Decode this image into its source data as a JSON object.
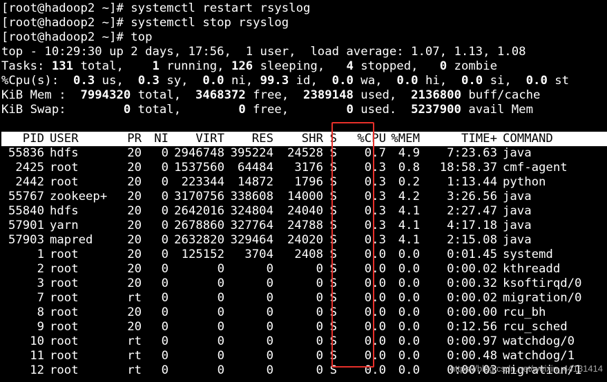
{
  "commands": [
    "[root@hadoop2 ~]# systemctl restart rsyslog",
    "[root@hadoop2 ~]# systemctl stop rsyslog",
    "[root@hadoop2 ~]# top"
  ],
  "summary": {
    "top_line": "top - 10:29:30 up 2 days, 17:56,  1 user,  load average: 1.07, 1.13, 1.08",
    "tasks": {
      "label": "Tasks:",
      "total": "131",
      "total_lbl": " total,",
      "running": "1",
      "running_lbl": " running,",
      "sleeping": "126",
      "sleeping_lbl": " sleeping,",
      "stopped": "4",
      "stopped_lbl": " stopped,",
      "zombie": "0",
      "zombie_lbl": " zombie"
    },
    "cpu": {
      "label": "%Cpu(s):",
      "us": "0.3",
      "us_lbl": " us,",
      "sy": "0.3",
      "sy_lbl": " sy,",
      "ni": "0.0",
      "ni_lbl": " ni,",
      "id": "99.3",
      "id_lbl": " id,",
      "wa": "0.0",
      "wa_lbl": " wa,",
      "hi": "0.0",
      "hi_lbl": " hi,",
      "si": "0.0",
      "si_lbl": " si,",
      "st": "0.0",
      "st_lbl": " st"
    },
    "mem": {
      "label": "KiB Mem :",
      "total": "7994320",
      "total_lbl": " total,",
      "free": "3468372",
      "free_lbl": " free,",
      "used": "2389148",
      "used_lbl": " used,",
      "buff": "2136800",
      "buff_lbl": " buff/cache"
    },
    "swap": {
      "label": "KiB Swap:",
      "total": "0",
      "total_lbl": " total,",
      "free": "0",
      "free_lbl": " free,",
      "used": "0",
      "used_lbl": " used.",
      "avail": "5237900",
      "avail_lbl": " avail Mem"
    }
  },
  "columns": {
    "pid": "PID",
    "user": "USER",
    "pr": "PR",
    "ni": "NI",
    "virt": "VIRT",
    "res": "RES",
    "shr": "SHR",
    "s": "S",
    "cpu": "%CPU",
    "mem": "%MEM",
    "time": "TIME+",
    "cmd": "COMMAND"
  },
  "processes": [
    {
      "pid": "55836",
      "user": "hdfs",
      "pr": "20",
      "ni": "0",
      "virt": "2946748",
      "res": "395224",
      "shr": "24528",
      "s": "S",
      "cpu": "0.7",
      "mem": "4.9",
      "time": "7:23.63",
      "cmd": "java"
    },
    {
      "pid": "2425",
      "user": "root",
      "pr": "20",
      "ni": "0",
      "virt": "1537560",
      "res": "64484",
      "shr": "3176",
      "s": "S",
      "cpu": "0.3",
      "mem": "0.8",
      "time": "18:58.37",
      "cmd": "cmf-agent"
    },
    {
      "pid": "2442",
      "user": "root",
      "pr": "20",
      "ni": "0",
      "virt": "223344",
      "res": "14872",
      "shr": "1796",
      "s": "S",
      "cpu": "0.3",
      "mem": "0.2",
      "time": "1:13.44",
      "cmd": "python"
    },
    {
      "pid": "55767",
      "user": "zookeep+",
      "pr": "20",
      "ni": "0",
      "virt": "3170756",
      "res": "338608",
      "shr": "14000",
      "s": "S",
      "cpu": "0.3",
      "mem": "4.2",
      "time": "3:26.56",
      "cmd": "java"
    },
    {
      "pid": "55840",
      "user": "hdfs",
      "pr": "20",
      "ni": "0",
      "virt": "2642016",
      "res": "324804",
      "shr": "24040",
      "s": "S",
      "cpu": "0.3",
      "mem": "4.1",
      "time": "2:27.47",
      "cmd": "java"
    },
    {
      "pid": "57901",
      "user": "yarn",
      "pr": "20",
      "ni": "0",
      "virt": "2678860",
      "res": "327764",
      "shr": "24788",
      "s": "S",
      "cpu": "0.3",
      "mem": "4.1",
      "time": "4:17.18",
      "cmd": "java"
    },
    {
      "pid": "57903",
      "user": "mapred",
      "pr": "20",
      "ni": "0",
      "virt": "2632820",
      "res": "329464",
      "shr": "24020",
      "s": "S",
      "cpu": "0.3",
      "mem": "4.1",
      "time": "2:15.08",
      "cmd": "java"
    },
    {
      "pid": "1",
      "user": "root",
      "pr": "20",
      "ni": "0",
      "virt": "125152",
      "res": "3704",
      "shr": "2408",
      "s": "S",
      "cpu": "0.0",
      "mem": "0.0",
      "time": "0:01.45",
      "cmd": "systemd"
    },
    {
      "pid": "2",
      "user": "root",
      "pr": "20",
      "ni": "0",
      "virt": "0",
      "res": "0",
      "shr": "0",
      "s": "S",
      "cpu": "0.0",
      "mem": "0.0",
      "time": "0:00.02",
      "cmd": "kthreadd"
    },
    {
      "pid": "3",
      "user": "root",
      "pr": "20",
      "ni": "0",
      "virt": "0",
      "res": "0",
      "shr": "0",
      "s": "S",
      "cpu": "0.0",
      "mem": "0.0",
      "time": "0:00.32",
      "cmd": "ksoftirqd/0"
    },
    {
      "pid": "7",
      "user": "root",
      "pr": "rt",
      "ni": "0",
      "virt": "0",
      "res": "0",
      "shr": "0",
      "s": "S",
      "cpu": "0.0",
      "mem": "0.0",
      "time": "0:00.02",
      "cmd": "migration/0"
    },
    {
      "pid": "8",
      "user": "root",
      "pr": "20",
      "ni": "0",
      "virt": "0",
      "res": "0",
      "shr": "0",
      "s": "S",
      "cpu": "0.0",
      "mem": "0.0",
      "time": "0:00.00",
      "cmd": "rcu_bh"
    },
    {
      "pid": "9",
      "user": "root",
      "pr": "20",
      "ni": "0",
      "virt": "0",
      "res": "0",
      "shr": "0",
      "s": "S",
      "cpu": "0.0",
      "mem": "0.0",
      "time": "0:12.56",
      "cmd": "rcu_sched"
    },
    {
      "pid": "10",
      "user": "root",
      "pr": "rt",
      "ni": "0",
      "virt": "0",
      "res": "0",
      "shr": "0",
      "s": "S",
      "cpu": "0.0",
      "mem": "0.0",
      "time": "0:00.97",
      "cmd": "watchdog/0"
    },
    {
      "pid": "11",
      "user": "root",
      "pr": "rt",
      "ni": "0",
      "virt": "0",
      "res": "0",
      "shr": "0",
      "s": "S",
      "cpu": "0.0",
      "mem": "0.0",
      "time": "0:00.48",
      "cmd": "watchdog/1"
    },
    {
      "pid": "12",
      "user": "root",
      "pr": "rt",
      "ni": "0",
      "virt": "0",
      "res": "0",
      "shr": "0",
      "s": "S",
      "cpu": "0.0",
      "mem": "0.0",
      "time": "0:00.03",
      "cmd": "migration/1"
    }
  ],
  "annotation": {
    "color": "#e8302a"
  },
  "watermark": "https://blog.csdn.net/weixin_44131414"
}
